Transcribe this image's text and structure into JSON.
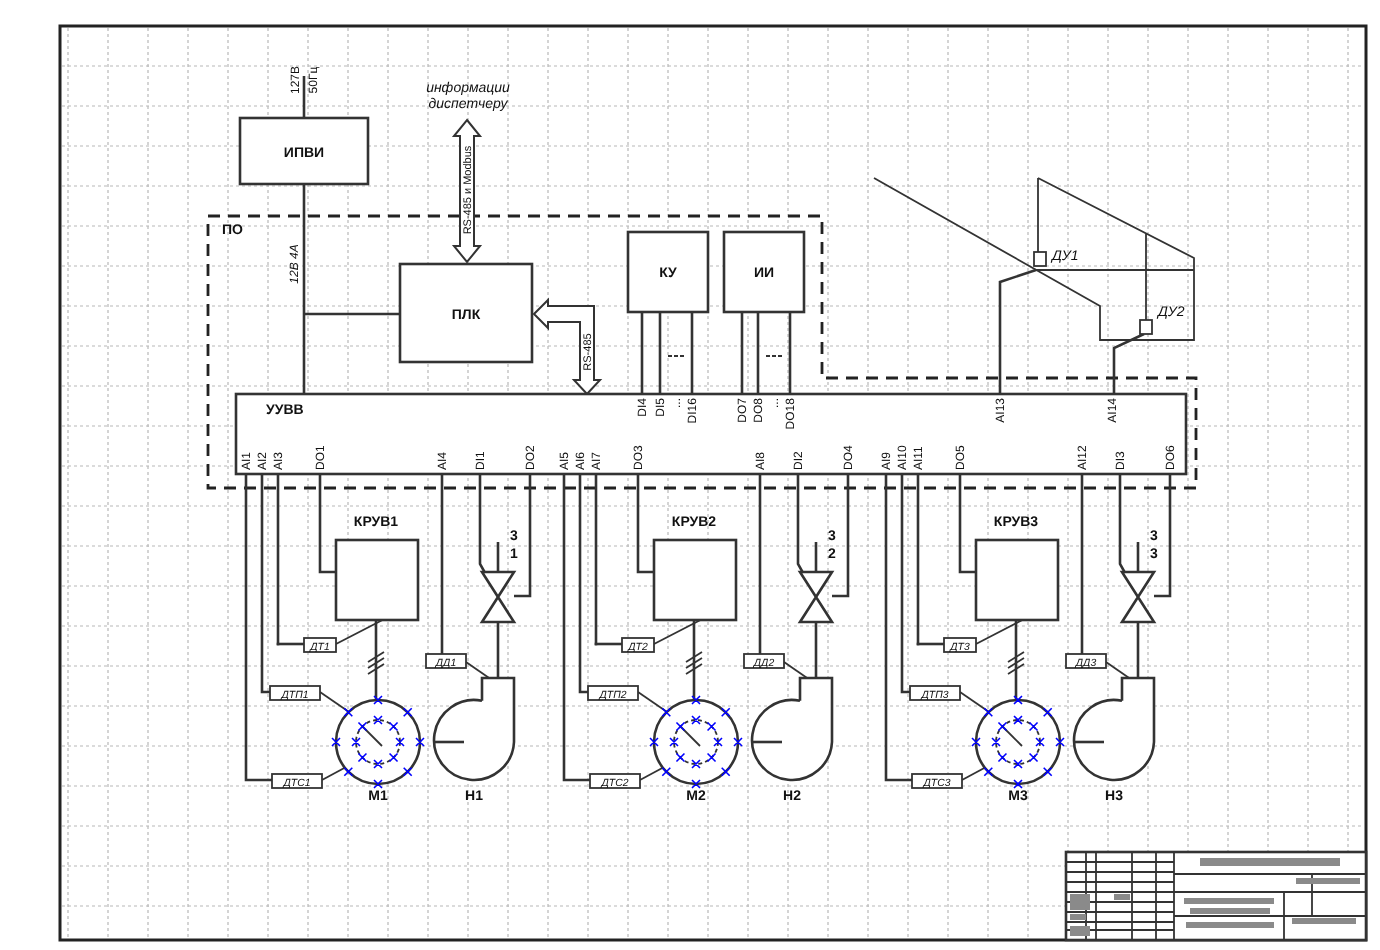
{
  "power_supply": {
    "label": "ИПВИ",
    "input_voltage": "127В",
    "input_frequency": "50Гц",
    "output_rating": "12В 4А"
  },
  "boundary": {
    "label": "ПО"
  },
  "dispatcher_link": {
    "caption": [
      "информации",
      "диспетчеру"
    ],
    "protocol": "RS-485 и Modbus"
  },
  "plc": {
    "label": "ПЛК",
    "link": "RS-485"
  },
  "modules": [
    {
      "label": "КУ",
      "pins": [
        "DI4",
        "DI5",
        "...",
        "DI16"
      ]
    },
    {
      "label": "ИИ",
      "pins": [
        "DO7",
        "DO8",
        "...",
        "DO18"
      ]
    }
  ],
  "io_unit": {
    "label": "УУВВ",
    "bottom_pins": [
      "AI1",
      "AI2",
      "AI3",
      "DO1",
      "AI4",
      "DI1",
      "DO2",
      "AI5",
      "AI6",
      "AI7",
      "DO3",
      "AI8",
      "DI2",
      "DO4",
      "AI9",
      "AI10",
      "AI11",
      "DO5",
      "AI12",
      "DI3",
      "DO6"
    ],
    "level_pins": [
      "AI13",
      "AI14"
    ]
  },
  "level_sensors": [
    {
      "label": "ДУ1"
    },
    {
      "label": "ДУ2"
    }
  ],
  "units": [
    {
      "cabinet": "КРУВ1",
      "tag_upper": "ДТ1",
      "tag_middle": "ДТП1",
      "tag_lower": "ДТС1",
      "motor": "М1",
      "gauge_tag": "ДД1",
      "pump": "Н1",
      "valve_mark_upper": "3",
      "valve_mark_lower": "1"
    },
    {
      "cabinet": "КРУВ2",
      "tag_upper": "ДТ2",
      "tag_middle": "ДТП2",
      "tag_lower": "ДТС2",
      "motor": "М2",
      "gauge_tag": "ДД2",
      "pump": "Н2",
      "valve_mark_upper": "3",
      "valve_mark_lower": "2"
    },
    {
      "cabinet": "КРУВ3",
      "tag_upper": "ДТ3",
      "tag_middle": "ДТП3",
      "tag_lower": "ДТС3",
      "motor": "М3",
      "gauge_tag": "ДД3",
      "pump": "Н3",
      "valve_mark_upper": "3",
      "valve_mark_lower": "3"
    }
  ]
}
